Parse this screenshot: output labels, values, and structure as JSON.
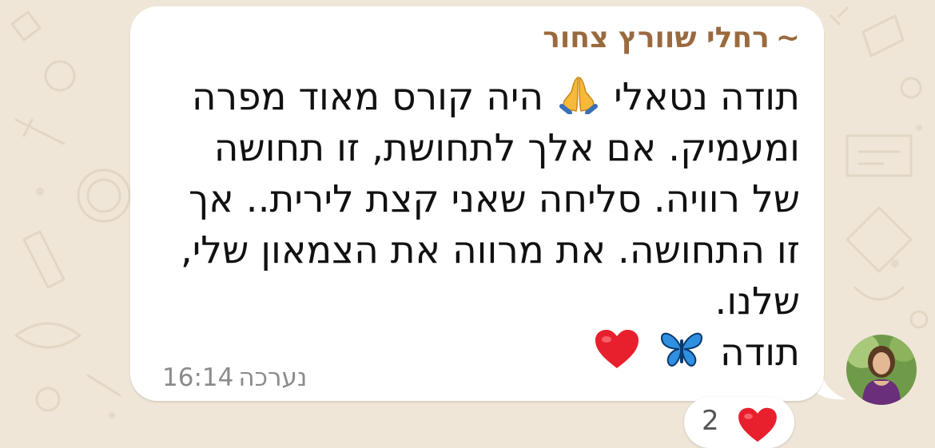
{
  "message": {
    "sender": "רחלי שוורץ צחור",
    "sender_prefix": "~",
    "lines": [
      "תודה נטאלי",
      "היה קורס מאוד מפרה",
      "ומעמיק. אם אלך לתחושת, זו תחושה",
      "של רוויה. סליחה שאני קצת לירית.. אך",
      "זו התחושה. את מרווה את הצמאון שלי,",
      "שלנו.",
      "תודה"
    ],
    "emojis": [
      "folded-hands",
      "butterfly",
      "red-heart"
    ],
    "edited_label": "נערכה",
    "time": "16:14"
  },
  "reaction": {
    "count": "2",
    "emoji": "red-heart"
  },
  "colors": {
    "sender": "#9a6a3f",
    "bubble": "#ffffff",
    "wallpaper": "#efe6d8",
    "meta": "#8b8b8b"
  }
}
